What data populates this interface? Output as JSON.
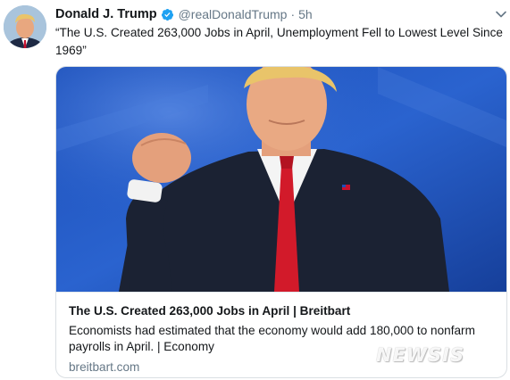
{
  "tweet": {
    "author_name": "Donald J. Trump",
    "verified_icon": "verified-badge-icon",
    "handle": "@realDonaldTrump",
    "separator": "·",
    "time": "5h",
    "text": "“The U.S. Created 263,000 Jobs in April, Unemployment Fell to Lowest Level Since 1969”"
  },
  "card": {
    "title": "The U.S. Created 263,000 Jobs in April | Breitbart",
    "description": "Economists had estimated that the economy would add 180,000 to nonfarm payrolls in April. | Economy",
    "domain": "breitbart.com"
  },
  "watermark": "NEWSIS",
  "colors": {
    "verified_blue": "#1da1f2",
    "secondary_text": "#657786",
    "card_border": "#dadfe3"
  }
}
